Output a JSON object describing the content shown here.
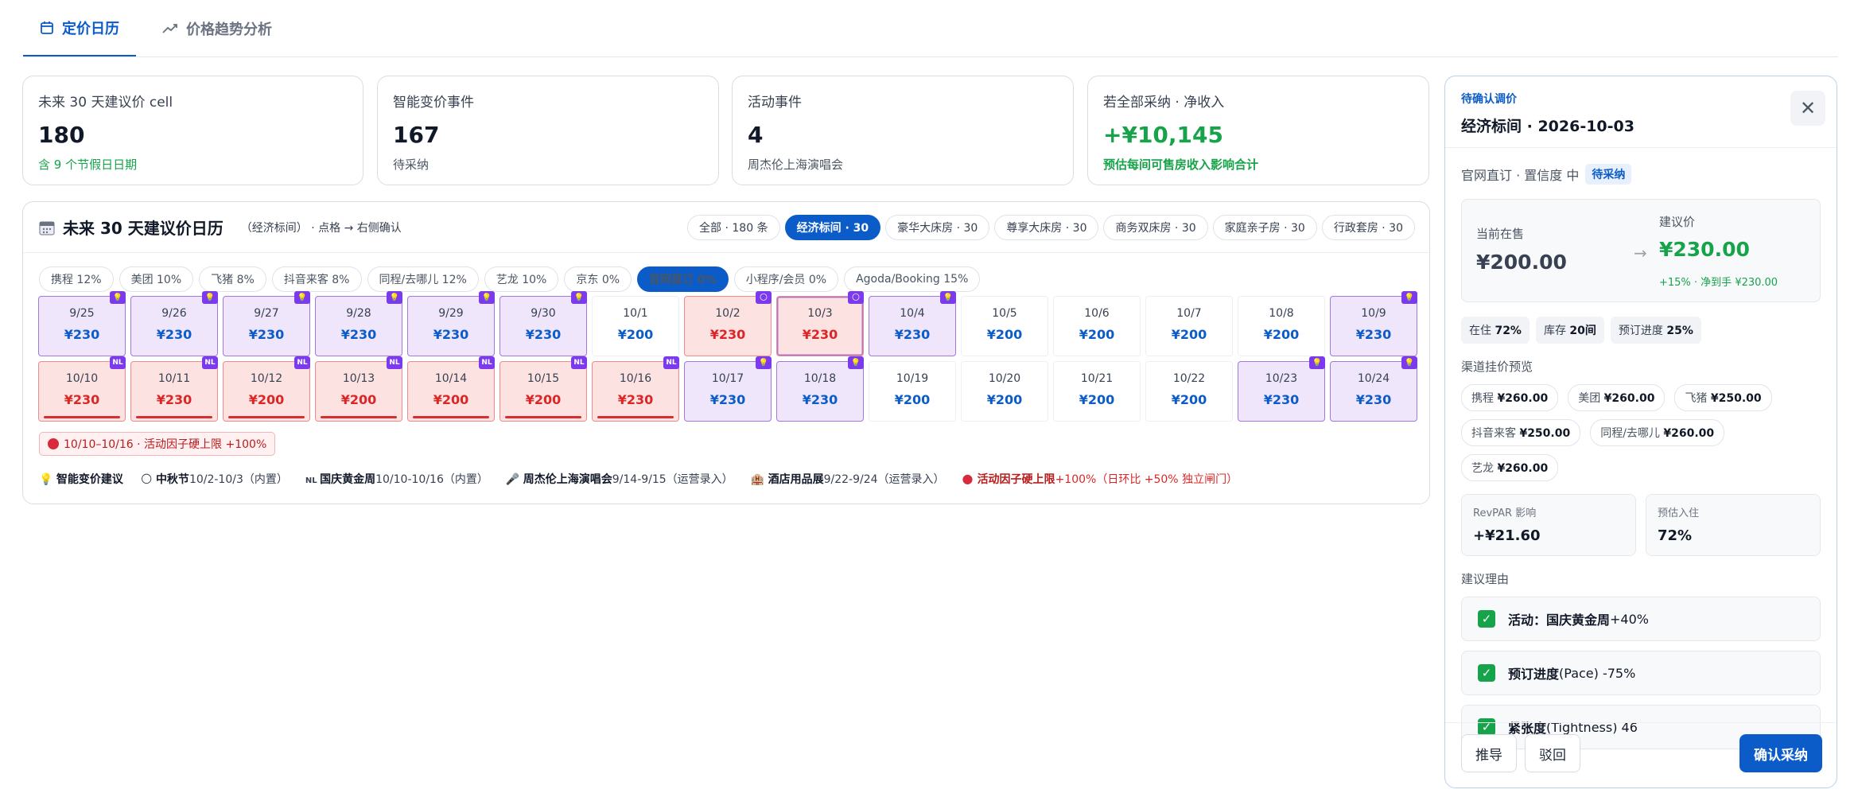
{
  "tabs": [
    {
      "label": "定价日历",
      "icon": "calendar-icon"
    },
    {
      "label": "价格趋势分析",
      "icon": "trend-icon"
    }
  ],
  "kpis": [
    {
      "title": "未来 30 天建议价 cell",
      "value": "180",
      "sub": "含 9 个节假日日期"
    },
    {
      "title": "智能变价事件",
      "value": "167",
      "sub": "待采纳"
    },
    {
      "title": "活动事件",
      "value": "4",
      "sub": "周杰伦上海演唱会"
    },
    {
      "title": "若全部采纳 · 净收入",
      "value": "+¥10,145",
      "sub": "预估每间可售房收入影响合计"
    }
  ],
  "calendar": {
    "title": "未来 30 天建议价日历",
    "subtitle": "（经济标间） · 点格 → 右侧确认",
    "rooms": [
      "全部 · 180 条",
      "经济标间 · 30",
      "豪华大床房 · 30",
      "尊享大床房 · 30",
      "商务双床房 · 30",
      "家庭亲子房 · 30",
      "行政套房 · 30"
    ],
    "selected_room": 1,
    "channels": [
      "携程 12%",
      "美团 10%",
      "飞猪 8%",
      "抖音来客 8%",
      "同程/去哪儿 12%",
      "艺龙 10%",
      "京东 0%",
      "官网直订 0%",
      "小程序/会员 0%",
      "Agoda/Booking 15%"
    ],
    "selected_channel": 7,
    "cells": [
      {
        "date": "9/25",
        "price": "¥230",
        "style": "purple",
        "badge": "💡"
      },
      {
        "date": "9/26",
        "price": "¥230",
        "style": "purple",
        "badge": "💡"
      },
      {
        "date": "9/27",
        "price": "¥230",
        "style": "purple",
        "badge": "💡"
      },
      {
        "date": "9/28",
        "price": "¥230",
        "style": "purple",
        "badge": "💡"
      },
      {
        "date": "9/29",
        "price": "¥230",
        "style": "purple",
        "badge": "💡"
      },
      {
        "date": "9/30",
        "price": "¥230",
        "style": "purple",
        "badge": "💡"
      },
      {
        "date": "10/1",
        "price": "¥200",
        "style": "plain",
        "badge": ""
      },
      {
        "date": "10/2",
        "price": "¥230",
        "style": "red",
        "badge": "🌕"
      },
      {
        "date": "10/3",
        "price": "¥230",
        "style": "red ring",
        "badge": "🌕"
      },
      {
        "date": "10/4",
        "price": "¥230",
        "style": "purple",
        "badge": "💡"
      },
      {
        "date": "10/5",
        "price": "¥200",
        "style": "plain",
        "badge": ""
      },
      {
        "date": "10/6",
        "price": "¥200",
        "style": "plain",
        "badge": ""
      },
      {
        "date": "10/7",
        "price": "¥200",
        "style": "plain",
        "badge": ""
      },
      {
        "date": "10/8",
        "price": "¥200",
        "style": "plain",
        "badge": ""
      },
      {
        "date": "10/9",
        "price": "¥230",
        "style": "purple",
        "badge": "💡"
      },
      {
        "date": "10/10",
        "price": "¥230",
        "style": "red redline",
        "badge": "NL"
      },
      {
        "date": "10/11",
        "price": "¥230",
        "style": "red redline",
        "badge": "NL"
      },
      {
        "date": "10/12",
        "price": "¥200",
        "style": "red redline",
        "badge": "NL"
      },
      {
        "date": "10/13",
        "price": "¥200",
        "style": "red redline",
        "badge": "NL"
      },
      {
        "date": "10/14",
        "price": "¥200",
        "style": "red redline",
        "badge": "NL"
      },
      {
        "date": "10/15",
        "price": "¥200",
        "style": "red redline",
        "badge": "NL"
      },
      {
        "date": "10/16",
        "price": "¥230",
        "style": "red redline",
        "badge": "NL"
      },
      {
        "date": "10/17",
        "price": "¥230",
        "style": "purple",
        "badge": "💡"
      },
      {
        "date": "10/18",
        "price": "¥230",
        "style": "purple",
        "badge": "💡"
      },
      {
        "date": "10/19",
        "price": "¥200",
        "style": "plain",
        "badge": ""
      },
      {
        "date": "10/20",
        "price": "¥200",
        "style": "plain",
        "badge": ""
      },
      {
        "date": "10/21",
        "price": "¥200",
        "style": "plain",
        "badge": ""
      },
      {
        "date": "10/22",
        "price": "¥200",
        "style": "plain",
        "badge": ""
      },
      {
        "date": "10/23",
        "price": "¥230",
        "style": "purple",
        "badge": "💡"
      },
      {
        "date": "10/24",
        "price": "¥230",
        "style": "purple",
        "badge": "💡"
      }
    ],
    "cap_note": "10/10–10/16 · 活动因子硬上限 +100%",
    "legend": [
      {
        "icon": "💡",
        "bold": "智能变价建议",
        "rest": ""
      },
      {
        "icon": "🌕",
        "bold": "中秋节",
        "rest": "10/2-10/3（内置）"
      },
      {
        "icon": "NL",
        "bold": "国庆黄金周",
        "rest": "10/10-10/16（内置）"
      },
      {
        "icon": "🎤",
        "bold": "周杰伦上海演唱会",
        "rest": "9/14-9/15（运营录入）"
      },
      {
        "icon": "🏨",
        "bold": "酒店用品展",
        "rest": "9/22-9/24（运营录入）"
      },
      {
        "icon": "●",
        "bold": "活动因子硬上限",
        "rest": "+100%（日环比 +50% 独立闸门）"
      }
    ]
  },
  "panel": {
    "kicker": "待确认调价",
    "title": "经济标间 · 2026-10-03",
    "meta": "官网直订 · 置信度 中",
    "status": "待采纳",
    "current_label": "当前在售",
    "current_price": "¥200.00",
    "arrow": "→",
    "suggest_label": "建议价",
    "suggest_price": "¥230.00",
    "suggest_delta": "+15% · 净到手 ¥230.00",
    "stats": [
      {
        "label": "在住 ",
        "value": "72%"
      },
      {
        "label": "库存 ",
        "value": "20间"
      },
      {
        "label": "预订进度 ",
        "value": "25%"
      }
    ],
    "channel_section": "渠道挂价预览",
    "channel_prices": [
      {
        "name": "携程",
        "price": "¥260.00"
      },
      {
        "name": "美团",
        "price": "¥260.00"
      },
      {
        "name": "飞猪",
        "price": "¥250.00"
      },
      {
        "name": "抖音来客",
        "price": "¥250.00"
      },
      {
        "name": "同程/去哪儿",
        "price": "¥260.00"
      },
      {
        "name": "艺龙",
        "price": "¥260.00"
      }
    ],
    "revpar_label": "RevPAR 影响",
    "revpar_value": "+¥21.60",
    "occ_label": "预估入住",
    "occ_value": "72%",
    "reason_section": "建议理由",
    "reasons": [
      {
        "bold": "活动：国庆黄金周",
        "rest": "+40%"
      },
      {
        "bold": "预订进度",
        "rest": " (Pace) -75%"
      },
      {
        "bold": "紧张度",
        "rest": " (Tightness) 46"
      }
    ],
    "btn_derive": "推导",
    "btn_reject": "驳回",
    "btn_confirm": "确认采纳"
  }
}
